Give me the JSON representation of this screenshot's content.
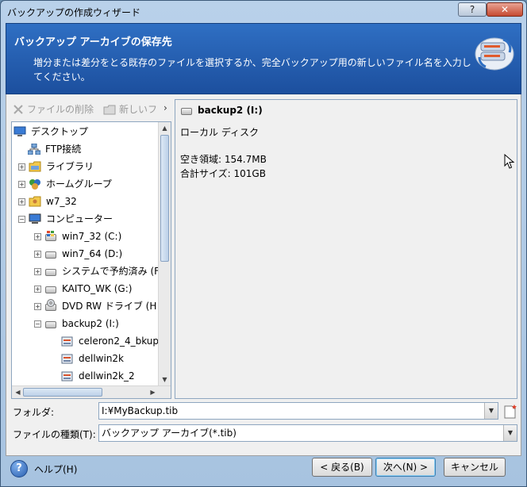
{
  "window": {
    "title": "バックアップの作成ウィザード",
    "help_button": "?",
    "close_button": "✕"
  },
  "header": {
    "title": "バックアップ アーカイブの保存先",
    "description": "増分または差分をとる既存のファイルを選択するか、完全バックアップ用の新しいファイル名を入力してください。"
  },
  "left_toolbar": {
    "delete_label": "ファイルの削除",
    "newfolder_label": "新しいフ"
  },
  "tree": {
    "items": [
      {
        "label": "デスクトップ",
        "icon": "desktop-icon"
      },
      {
        "label": "FTP接続",
        "icon": "network-icon"
      },
      {
        "label": "ライブラリ",
        "icon": "library-icon"
      },
      {
        "label": "ホームグループ",
        "icon": "homegroup-icon"
      },
      {
        "label": "w7_32",
        "icon": "user-folder-icon"
      },
      {
        "label": "コンピューター",
        "icon": "computer-icon"
      },
      {
        "label": "win7_32 (C:)",
        "icon": "windows-drive-icon"
      },
      {
        "label": "win7_64 (D:)",
        "icon": "drive-icon"
      },
      {
        "label": "システムで予約済み (F",
        "icon": "drive-icon"
      },
      {
        "label": "KAITO_WK (G:)",
        "icon": "drive-icon"
      },
      {
        "label": "DVD RW ドライブ (H",
        "icon": "dvd-drive-icon"
      },
      {
        "label": "backup2 (I:)",
        "icon": "drive-icon"
      },
      {
        "label": "celeron2_4_bkup",
        "icon": "archive-icon"
      },
      {
        "label": "dellwin2k",
        "icon": "archive-icon"
      },
      {
        "label": "dellwin2k_2",
        "icon": "archive-icon"
      }
    ]
  },
  "detail": {
    "name": "backup2 (I:)",
    "type": "ローカル ディスク",
    "free_space": "空き領域: 154.7MB",
    "total_size": "合計サイズ: 101GB"
  },
  "form": {
    "folder_label": "フォルダ:",
    "folder_value": "I:¥MyBackup.tib",
    "filetype_label": "ファイルの種類(T):",
    "filetype_value": "バックアップ アーカイブ(*.tib)"
  },
  "footer": {
    "help_label": "ヘルプ(H)",
    "back_label": "< 戻る(B)",
    "next_label": "次へ(N) >",
    "cancel_label": "キャンセル"
  }
}
